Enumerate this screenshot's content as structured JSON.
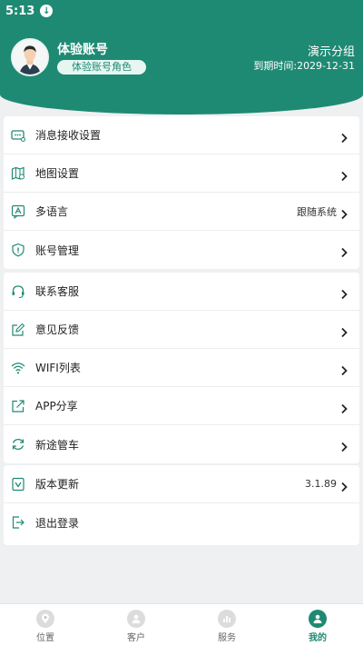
{
  "status_bar": {
    "time": "5:13"
  },
  "profile": {
    "name": "体验账号",
    "role": "体验账号角色",
    "group": "演示分组",
    "expire": "到期时间:2029-12-31"
  },
  "sections": [
    [
      {
        "label": "消息接收设置",
        "icon": "message-settings-icon"
      },
      {
        "label": "地图设置",
        "icon": "map-settings-icon"
      },
      {
        "label": "多语言",
        "icon": "language-icon",
        "value": "跟随系统"
      },
      {
        "label": "账号管理",
        "icon": "account-shield-icon"
      }
    ],
    [
      {
        "label": "联系客服",
        "icon": "headset-icon"
      },
      {
        "label": "意见反馈",
        "icon": "edit-icon"
      },
      {
        "label": "WIFI列表",
        "icon": "wifi-icon"
      },
      {
        "label": "APP分享",
        "icon": "share-icon"
      },
      {
        "label": "新途管车",
        "icon": "refresh-icon"
      }
    ],
    [
      {
        "label": "版本更新",
        "icon": "update-icon",
        "value": "3.1.89"
      },
      {
        "label": "退出登录",
        "icon": "logout-icon"
      }
    ]
  ],
  "tabs": [
    {
      "label": "位置",
      "icon": "location-icon"
    },
    {
      "label": "客户",
      "icon": "customer-icon"
    },
    {
      "label": "服务",
      "icon": "service-icon"
    },
    {
      "label": "我的",
      "icon": "me-icon",
      "active": true
    }
  ],
  "colors": {
    "primary": "#1f8a73",
    "background": "#eef0f2"
  }
}
